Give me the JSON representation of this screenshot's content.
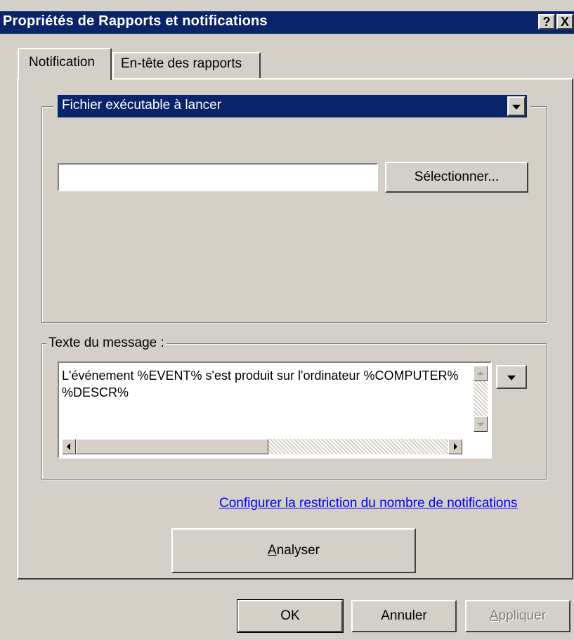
{
  "window": {
    "title": "Propriétés de Rapports et notifications",
    "help_button": "?",
    "close_button": "X"
  },
  "tabs": [
    {
      "label": "Notification",
      "active": true
    },
    {
      "label": "En-tête des rapports",
      "active": false
    }
  ],
  "notification": {
    "action_select": {
      "selected": "Fichier exécutable à lancer"
    },
    "path_input": {
      "value": ""
    },
    "select_button": "Sélectionner...",
    "message_group": {
      "label": "Texte du message :",
      "text": "L'événement %EVENT% s'est produit sur l'ordinateur %COMPUTER%\n%DESCR%"
    },
    "limit_link": "Configurer la restriction du nombre de notifications",
    "analyze_button": {
      "prefix": "A",
      "rest": "nalyser"
    }
  },
  "footer": {
    "ok": "OK",
    "cancel": "Annuler",
    "apply": {
      "prefix": "A",
      "rest": "ppliquer",
      "enabled": false
    }
  }
}
